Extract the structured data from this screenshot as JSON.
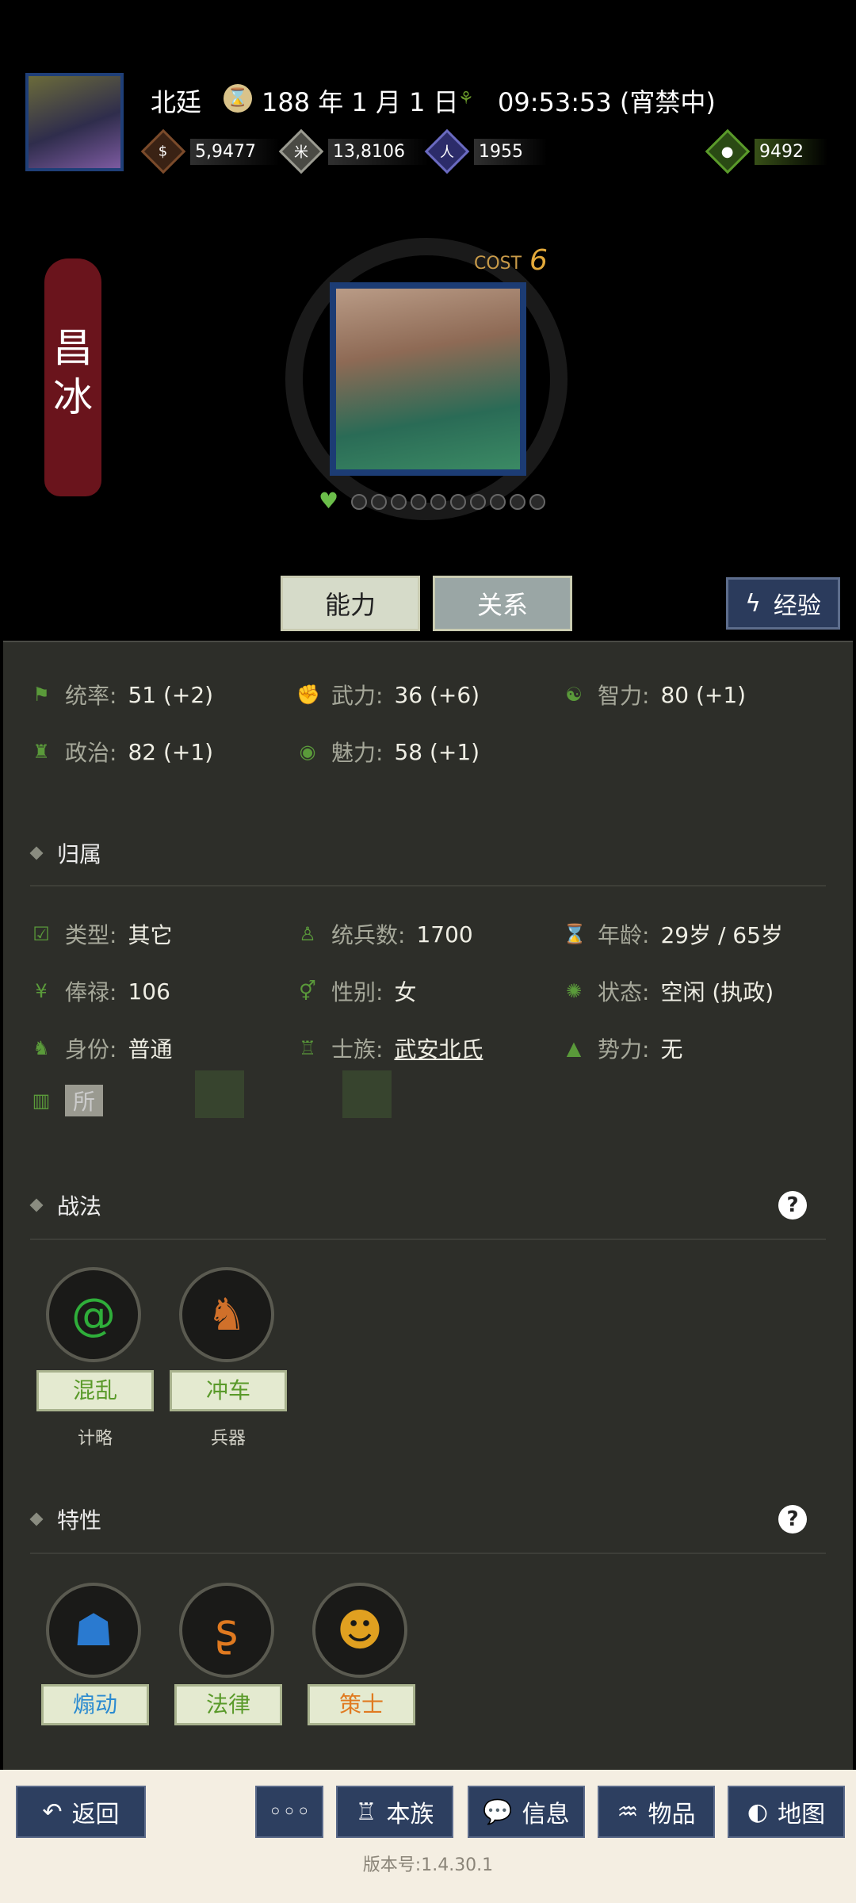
{
  "header": {
    "name": "北廷",
    "year_icon": "year-icon",
    "date": "188 年 1 月 1 日",
    "time": "09:53:53 (宵禁中)",
    "resources": [
      {
        "icon": "gold-coin-icon",
        "value": "5,9477",
        "color": "#7a4a2a"
      },
      {
        "icon": "grain-icon",
        "value": "13,8106",
        "color": "#8a8a80"
      },
      {
        "icon": "soldier-icon",
        "value": "1955",
        "color": "#5a5aa8"
      },
      {
        "icon": "money-bag-icon",
        "value": "9492",
        "color": "#5a9a2a"
      }
    ]
  },
  "character": {
    "name": "昌冰",
    "cost_label": "COST",
    "cost_value": "6"
  },
  "tabs": {
    "ability": "能力",
    "relations": "关系",
    "experience": "经验"
  },
  "stats": [
    {
      "label": "统率:",
      "value": "51 (+2)",
      "icon": "flag-icon"
    },
    {
      "label": "武力:",
      "value": "36 (+6)",
      "icon": "fist-icon"
    },
    {
      "label": "智力:",
      "value": "80 (+1)",
      "icon": "brain-icon"
    },
    {
      "label": "政治:",
      "value": "82 (+1)",
      "icon": "scroll-icon"
    },
    {
      "label": "魅力:",
      "value": "58 (+1)",
      "icon": "eye-icon"
    }
  ],
  "affiliation": {
    "title": "归属",
    "rows": [
      {
        "label": "类型:",
        "value": "其它"
      },
      {
        "label": "统兵数:",
        "value": "1700"
      },
      {
        "label": "年龄:",
        "value": "29岁 / 65岁"
      },
      {
        "label": "俸禄:",
        "value": "106"
      },
      {
        "label": "性别:",
        "value": "女"
      },
      {
        "label": "状态:",
        "value": "空闲 (执政)"
      },
      {
        "label": "身份:",
        "value": "普通"
      },
      {
        "label": "士族:",
        "value": "武安北氏"
      },
      {
        "label": "势力:",
        "value": "无"
      }
    ],
    "partial_label": "所"
  },
  "tactics": {
    "title": "战法",
    "help": "?",
    "items": [
      {
        "name": "混乱",
        "type": "计略",
        "icon": "swirl-icon"
      },
      {
        "name": "冲车",
        "type": "兵器",
        "icon": "siege-horse-icon"
      }
    ]
  },
  "traits": {
    "title": "特性",
    "help": "?",
    "items": [
      {
        "name": "煽动",
        "icon": "agitator-icon",
        "color": "#2a8ad0"
      },
      {
        "name": "法律",
        "icon": "law-icon",
        "color": "#5a9a2a"
      },
      {
        "name": "策士",
        "icon": "strategist-icon",
        "color": "#e07a20"
      }
    ]
  },
  "bottom": {
    "back": "返回",
    "more": "◦◦◦",
    "clan": "本族",
    "info": "信息",
    "items": "物品",
    "map": "地图",
    "version": "版本号:1.4.30.1"
  }
}
